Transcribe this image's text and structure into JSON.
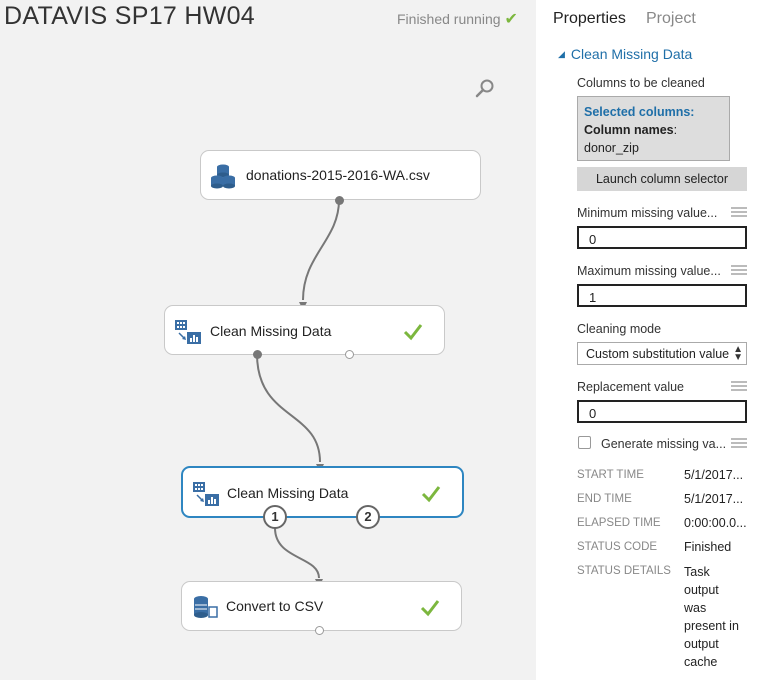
{
  "experiment": {
    "title": "DATAVIS SP17 HW04",
    "status": "Finished running"
  },
  "modules": [
    {
      "name": "donations-2015-2016-WA.csv"
    },
    {
      "name": "Clean Missing Data"
    },
    {
      "name": "Clean Missing Data"
    },
    {
      "name": "Convert to CSV"
    }
  ],
  "ports": {
    "out1": "1",
    "out2": "2"
  },
  "panel": {
    "tabs": [
      "Properties",
      "Project"
    ],
    "section_title": "Clean Missing Data",
    "columns_label": "Columns to be cleaned",
    "selected_columns_label": "Selected columns:",
    "column_names_label": "Column names",
    "column_names_value": "donor_zip",
    "launch_button": "Launch column selector",
    "min_label": "Minimum missing value...",
    "min_value": "0",
    "max_label": "Maximum missing value...",
    "max_value": "1",
    "mode_label": "Cleaning mode",
    "mode_value": "Custom substitution value",
    "replacement_label": "Replacement value",
    "replacement_value": "0",
    "generate_label": "Generate missing va...",
    "stats": [
      {
        "key": "START TIME",
        "value": "5/1/2017..."
      },
      {
        "key": "END TIME",
        "value": "5/1/2017..."
      },
      {
        "key": "ELAPSED TIME",
        "value": "0:00:00.0..."
      },
      {
        "key": "STATUS CODE",
        "value": "Finished"
      },
      {
        "key": "STATUS DETAILS",
        "value": "Task output was present in output cache"
      }
    ]
  },
  "colors": {
    "accent": "#2e86c1",
    "success": "#7cb73e",
    "link": "#1f6fa8"
  }
}
